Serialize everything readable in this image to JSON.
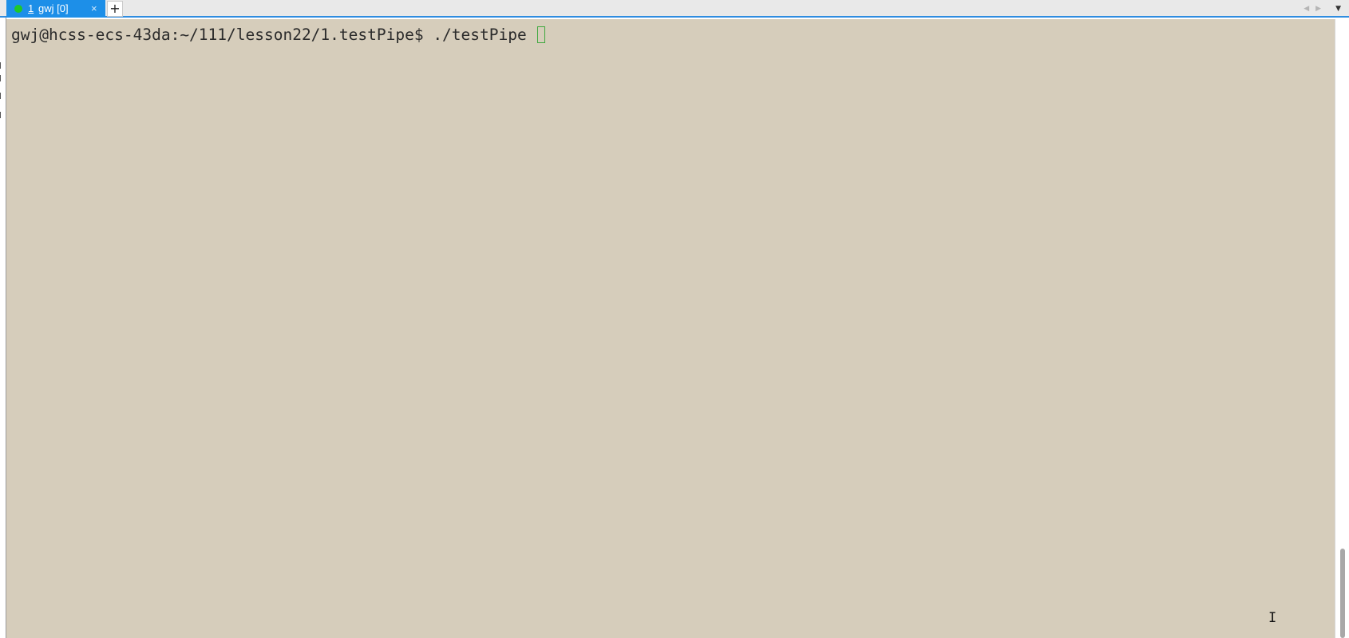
{
  "tabs": [
    {
      "number": "1",
      "title": "gwj [0]",
      "close_glyph": "×",
      "status_color": "#1ec828",
      "active": true
    }
  ],
  "tabbar": {
    "new_tab_glyph": "+",
    "nav_prev_glyph": "◀",
    "nav_next_glyph": "▶",
    "dropdown_glyph": "▼"
  },
  "terminal": {
    "background": "#d6cdbb",
    "prompt": "gwj@hcss-ecs-43da:~/111/lesson22/1.testPipe$ ",
    "command": "./testPipe "
  },
  "mouse_cursor_glyph": "I"
}
